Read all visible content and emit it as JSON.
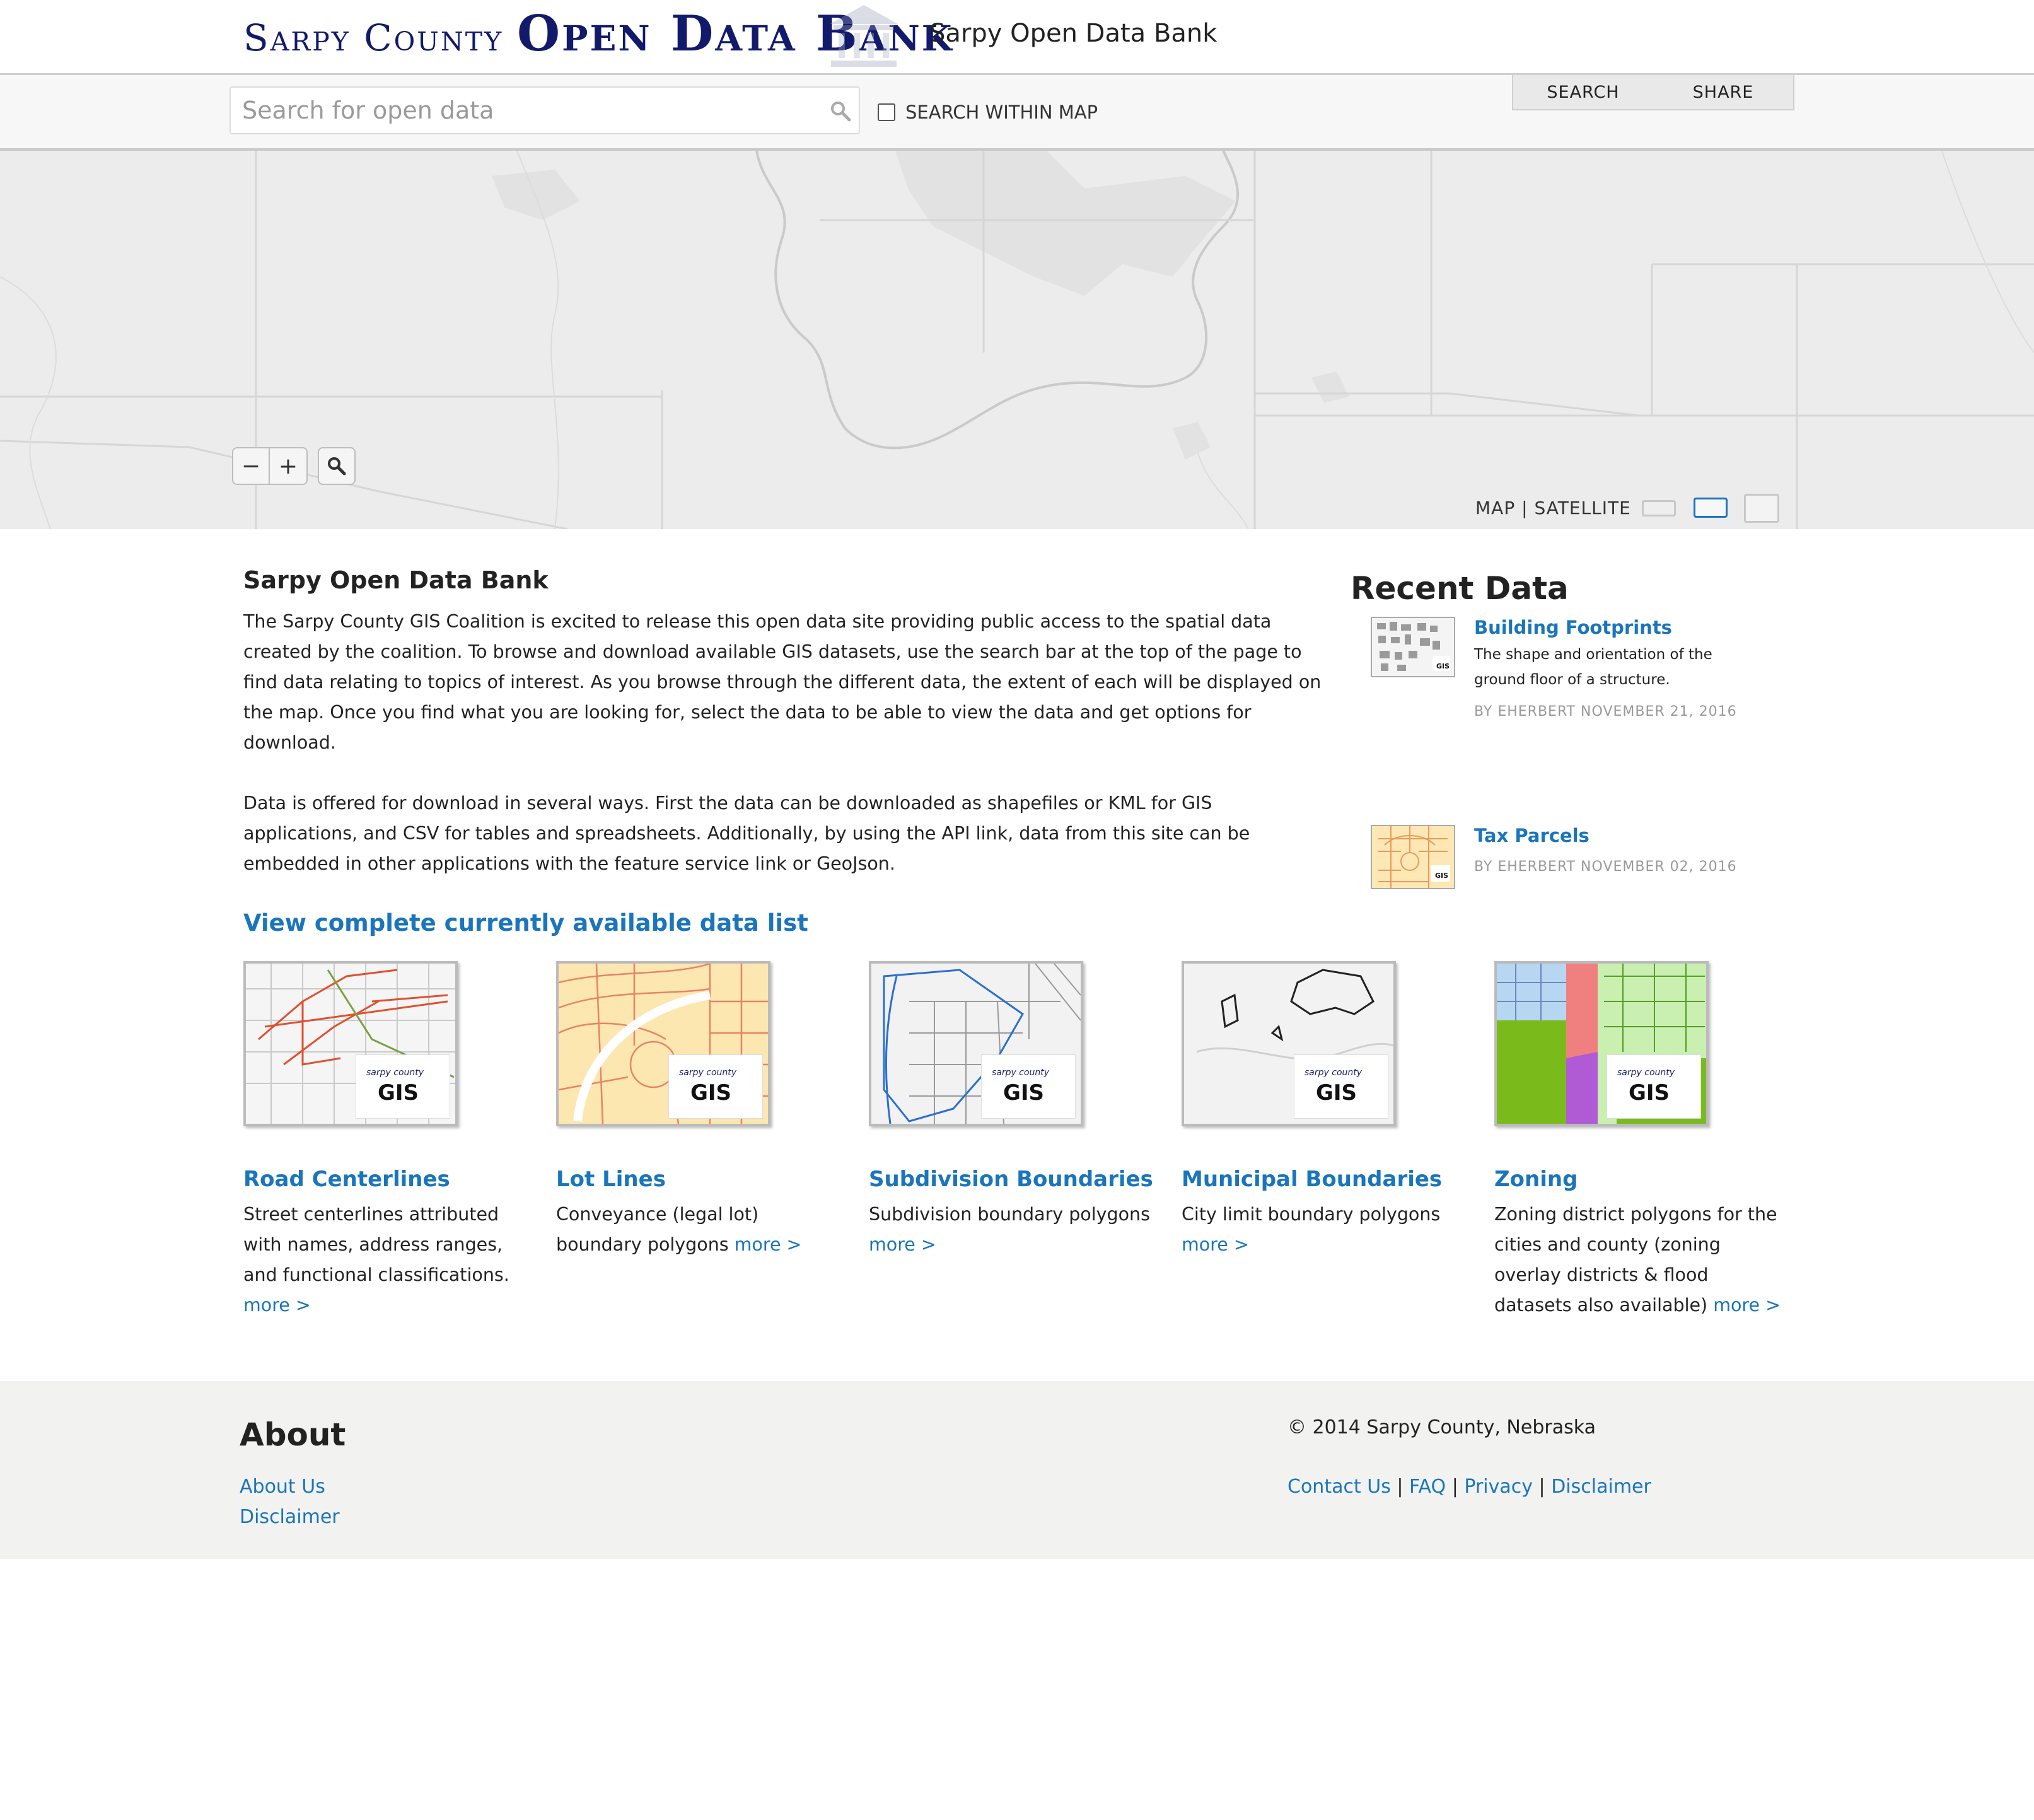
{
  "header": {
    "logo_line1": "Sarpy County",
    "logo_line2": "Open Data Bank",
    "site_title": "Sarpy Open Data Bank"
  },
  "search": {
    "placeholder": "Search for open data",
    "within_map_label": "SEARCH WITHIN MAP",
    "tabs": [
      "SEARCH",
      "SHARE"
    ]
  },
  "map": {
    "zoom_out": "−",
    "zoom_in": "+",
    "basemap_map": "MAP",
    "basemap_sep": "|",
    "basemap_satellite": "SATELLITE"
  },
  "intro": {
    "title": "Sarpy Open Data Bank",
    "paragraph1": "The Sarpy County GIS Coalition is excited to release this open data site providing public access to the spatial data created by the coalition. To browse and download available GIS datasets, use the search bar at the top of the page to find data relating to topics of interest. As you browse through the different data, the extent of each will be displayed on the map. Once you find what you are looking for, select the data to be able to view the data and get options for download.",
    "paragraph2": "Data is offered for download in several ways. First the data can be downloaded as shapefiles or KML for GIS applications, and CSV for tables and spreadsheets. Additionally, by using the API link, data from this site can be embedded in other applications with the feature service link or GeoJson.",
    "view_all_link": "View complete currently available data list"
  },
  "recent": {
    "heading": "Recent Data",
    "items": [
      {
        "title": "Building Footprints",
        "description": "The shape and orientation of the ground floor of a structure.",
        "meta": "BY EHERBERT NOVEMBER 21, 2016"
      },
      {
        "title": "Tax Parcels",
        "description": "",
        "meta": "BY EHERBERT NOVEMBER 02, 2016"
      }
    ]
  },
  "badge": {
    "line1": "sarpy county",
    "line2": "GIS"
  },
  "cards": [
    {
      "title": "Road Centerlines",
      "description": "Street centerlines attributed with names, address ranges, and functional classifications.",
      "more": "more >"
    },
    {
      "title": "Lot Lines",
      "description": "Conveyance (legal lot) boundary polygons",
      "more": "more >"
    },
    {
      "title": "Subdivision Boundaries",
      "description": "Subdivision boundary polygons",
      "more": "more >"
    },
    {
      "title": "Municipal Boundaries",
      "description": "City limit boundary polygons",
      "more": "more >"
    },
    {
      "title": "Zoning",
      "description": "Zoning district polygons for the cities and county (zoning overlay districts & flood datasets also available)",
      "more": "more >"
    }
  ],
  "footer": {
    "about_heading": "About",
    "about_links": [
      "About Us",
      "Disclaimer"
    ],
    "copyright": "© 2014 Sarpy County, Nebraska",
    "nav": [
      "Contact Us",
      "FAQ",
      "Privacy",
      "Disclaimer"
    ],
    "separator": "|"
  },
  "colors": {
    "link": "#1a75bb",
    "logo": "#121a6b",
    "footer_bg": "#f2f2f0",
    "map_bg": "#ececec"
  }
}
